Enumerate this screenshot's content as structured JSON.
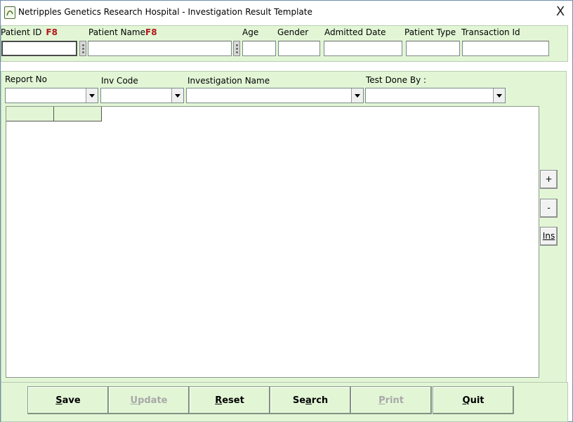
{
  "window": {
    "title": "Netripples Genetics Research Hospital  - Investigation Result Template",
    "close_glyph": "X"
  },
  "patient": {
    "patient_id_label": "Patient ID",
    "patient_id_hotkey": "F8",
    "patient_name_label": "Patient Name",
    "patient_name_hotkey": "F8",
    "age_label": "Age",
    "gender_label": "Gender",
    "admitted_date_label": "Admitted Date",
    "patient_type_label": "Patient Type",
    "transaction_id_label": "Transaction Id",
    "patient_id_value": "",
    "patient_name_value": "",
    "age_value": "",
    "gender_value": "",
    "admitted_date_value": "",
    "patient_type_value": "",
    "transaction_id_value": ""
  },
  "investigation": {
    "report_no_label": "Report No",
    "inv_code_label": "Inv Code",
    "investigation_name_label": "Investigation Name",
    "test_done_by_label": "Test Done By :",
    "report_no_value": "",
    "inv_code_value": "",
    "investigation_name_value": "",
    "test_done_by_value": ""
  },
  "grid": {
    "columns": [
      "",
      ""
    ]
  },
  "side_buttons": {
    "add": "+",
    "remove": "-",
    "insert": "Ins"
  },
  "actions": {
    "save": {
      "mnemonic": "S",
      "rest": "ave"
    },
    "update": {
      "mnemonic": "U",
      "rest": "pdate"
    },
    "reset": {
      "mnemonic": "R",
      "rest": "eset"
    },
    "search": {
      "prefix": "Se",
      "mnemonic": "a",
      "rest": "rch"
    },
    "print": {
      "mnemonic": "P",
      "rest": "rint"
    },
    "quit": {
      "mnemonic": "Q",
      "rest": "uit"
    }
  },
  "colors": {
    "panel_bg": "#e2f6d6",
    "hotkey_red": "#b01818"
  }
}
